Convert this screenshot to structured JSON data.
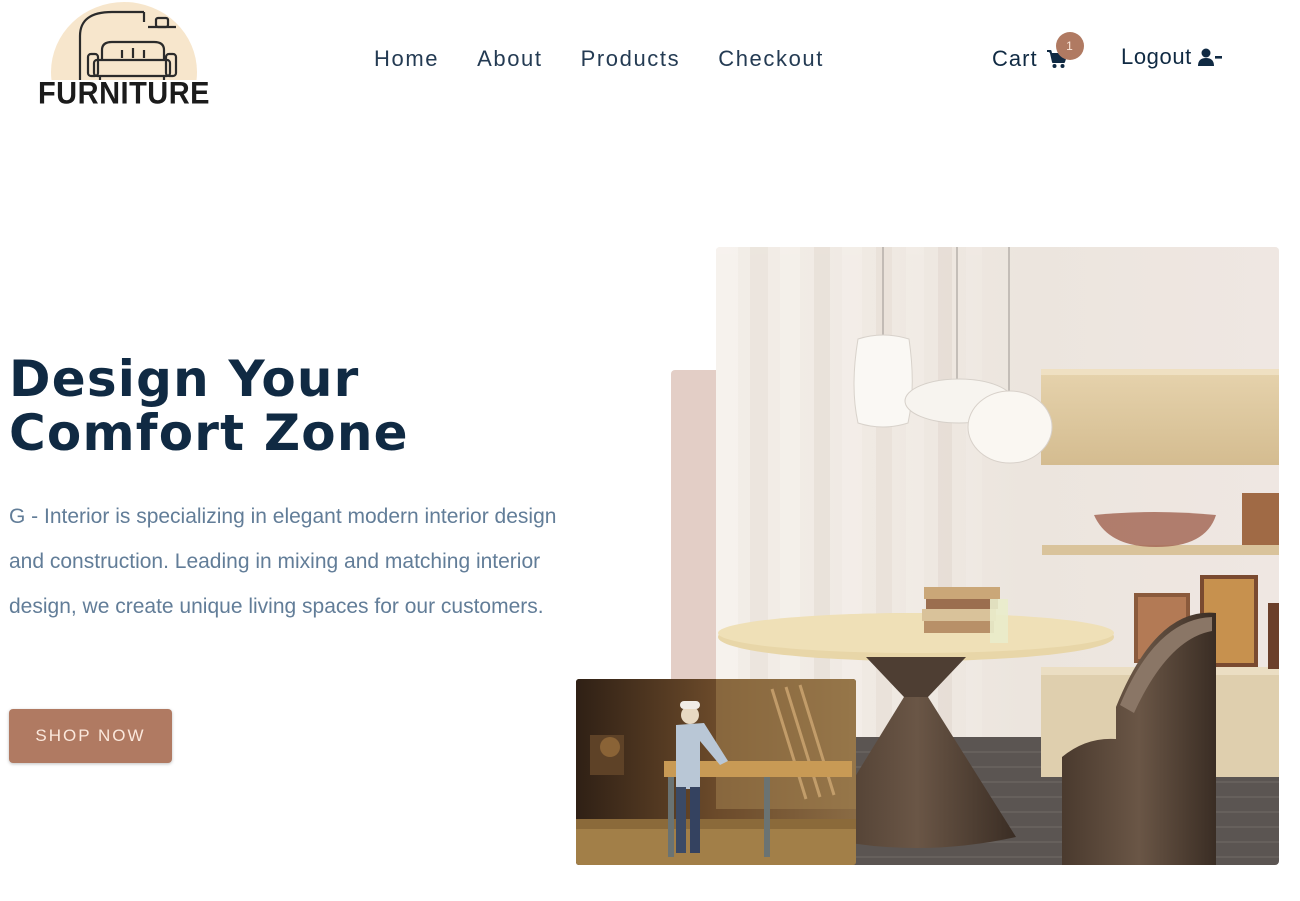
{
  "brand": {
    "logo_text": "FURNITURE",
    "logo_icon": "sofa-lamp-logo",
    "logo_bg_color": "#f7e6cc"
  },
  "nav": {
    "items": [
      {
        "label": "Home"
      },
      {
        "label": "About"
      },
      {
        "label": "Products"
      },
      {
        "label": "Checkout"
      }
    ]
  },
  "cart": {
    "label": "Cart",
    "icon": "shopping-cart-icon",
    "count": "1"
  },
  "account": {
    "logout_label": "Logout",
    "icon": "user-minus-icon"
  },
  "hero": {
    "title_line1": "Design Your",
    "title_line2": "Comfort Zone",
    "description": "G - Interior is specializing in elegant modern interior design and construction. Leading in mixing and matching interior design, we create unique living spaces for our customers.",
    "cta_label": "SHOP NOW",
    "main_image": "dining-room-pendant-lamps-image",
    "secondary_image": "carpenter-workshop-image"
  },
  "colors": {
    "primary_dark": "#102a43",
    "accent": "#b07a62",
    "accent_light": "#e3cec6",
    "text_muted": "#627d98"
  }
}
